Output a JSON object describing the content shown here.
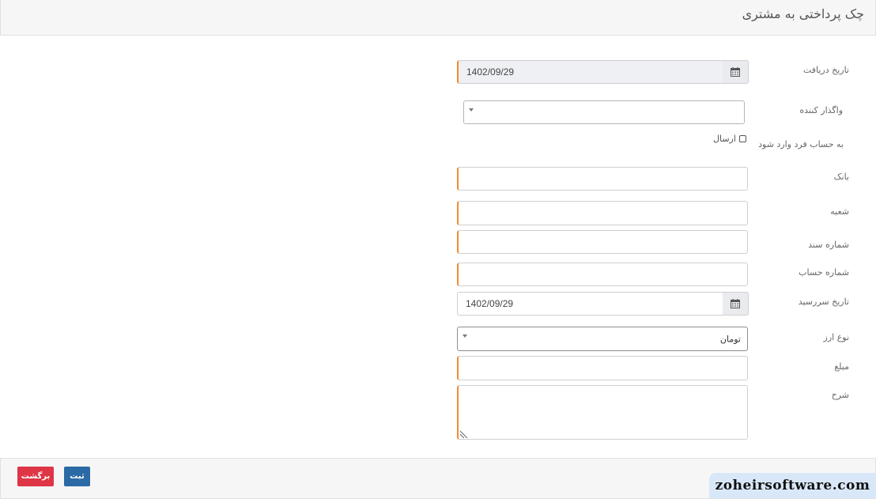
{
  "header": {
    "title": "چک پرداختی به مشتری"
  },
  "form": {
    "receive_date": {
      "label": "تاریخ دریافت",
      "value": "1402/09/29",
      "icon": "calendar-icon"
    },
    "assignor": {
      "label": "واگذار کننده",
      "value": ""
    },
    "to_account": {
      "label": "به حساب فرد وارد شود",
      "checkbox_label": "ارسال",
      "checked": false
    },
    "bank": {
      "label": "بانک",
      "value": ""
    },
    "branch": {
      "label": "شعبه",
      "value": ""
    },
    "document_number": {
      "label": "شماره سند",
      "value": ""
    },
    "account_number": {
      "label": "شماره حساب",
      "value": ""
    },
    "due_date": {
      "label": "تاریخ سررسید",
      "value": "1402/09/29",
      "icon": "calendar-icon"
    },
    "currency_type": {
      "label": "نوع ارز",
      "value": "تومان"
    },
    "amount": {
      "label": "مبلغ",
      "value": ""
    },
    "description": {
      "label": "شرح",
      "value": ""
    }
  },
  "footer": {
    "save_label": "ثبت",
    "back_label": "برگشت"
  },
  "watermark": "zoheirsoftware.com",
  "colors": {
    "accent_required": "#f08a2f",
    "save_button": "#2c6aa6",
    "back_button": "#de3547"
  }
}
